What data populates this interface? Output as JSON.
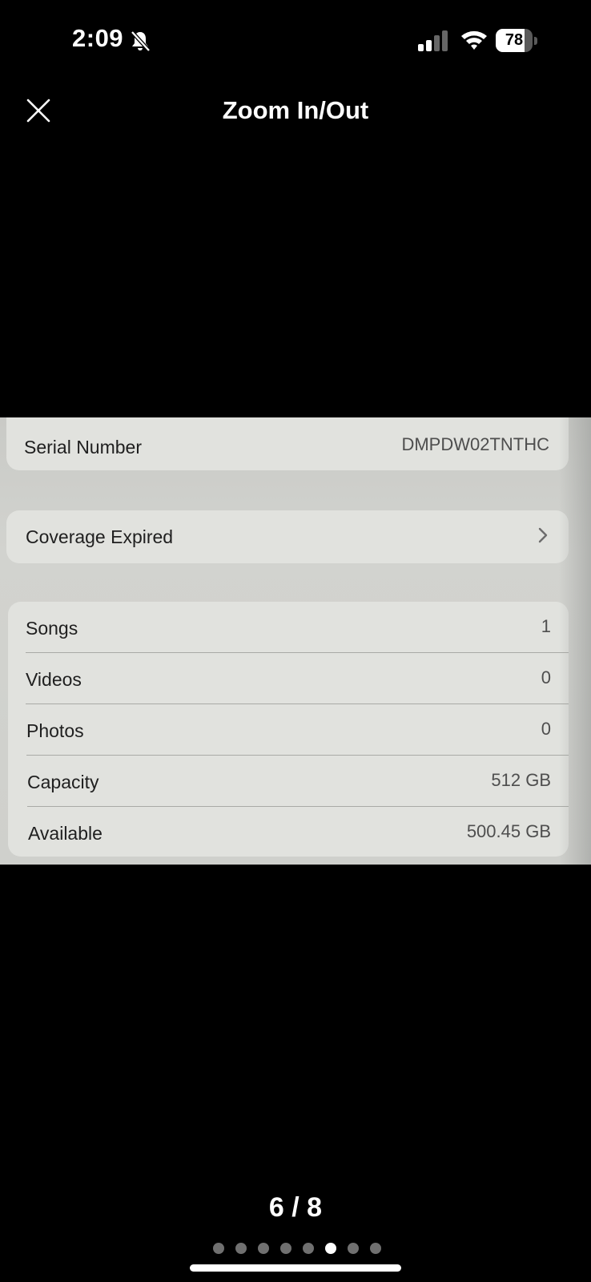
{
  "status_bar": {
    "time": "2:09",
    "silent_icon": "bell-slash-icon",
    "signal_icon": "cellular-signal-icon",
    "wifi_icon": "wifi-icon",
    "battery_level": "78",
    "battery_fraction": 0.78
  },
  "header": {
    "close_icon": "close-icon",
    "title": "Zoom In/Out"
  },
  "photo": {
    "serial": {
      "label": "Serial Number",
      "value": "DMPDW02TNTHC"
    },
    "coverage": {
      "label": "Coverage Expired",
      "icon": "chevron-right-icon"
    },
    "stats": [
      {
        "label": "Songs",
        "value": "1"
      },
      {
        "label": "Videos",
        "value": "0"
      },
      {
        "label": "Photos",
        "value": "0"
      },
      {
        "label": "Capacity",
        "value": "512 GB"
      },
      {
        "label": "Available",
        "value": "500.45 GB"
      }
    ]
  },
  "pager": {
    "counter": "6 / 8",
    "current": 6,
    "total": 8
  },
  "colors": {
    "background": "#000000",
    "photo_card": "#e1e2de",
    "dot_inactive": "#707070",
    "dot_active": "#ffffff"
  }
}
